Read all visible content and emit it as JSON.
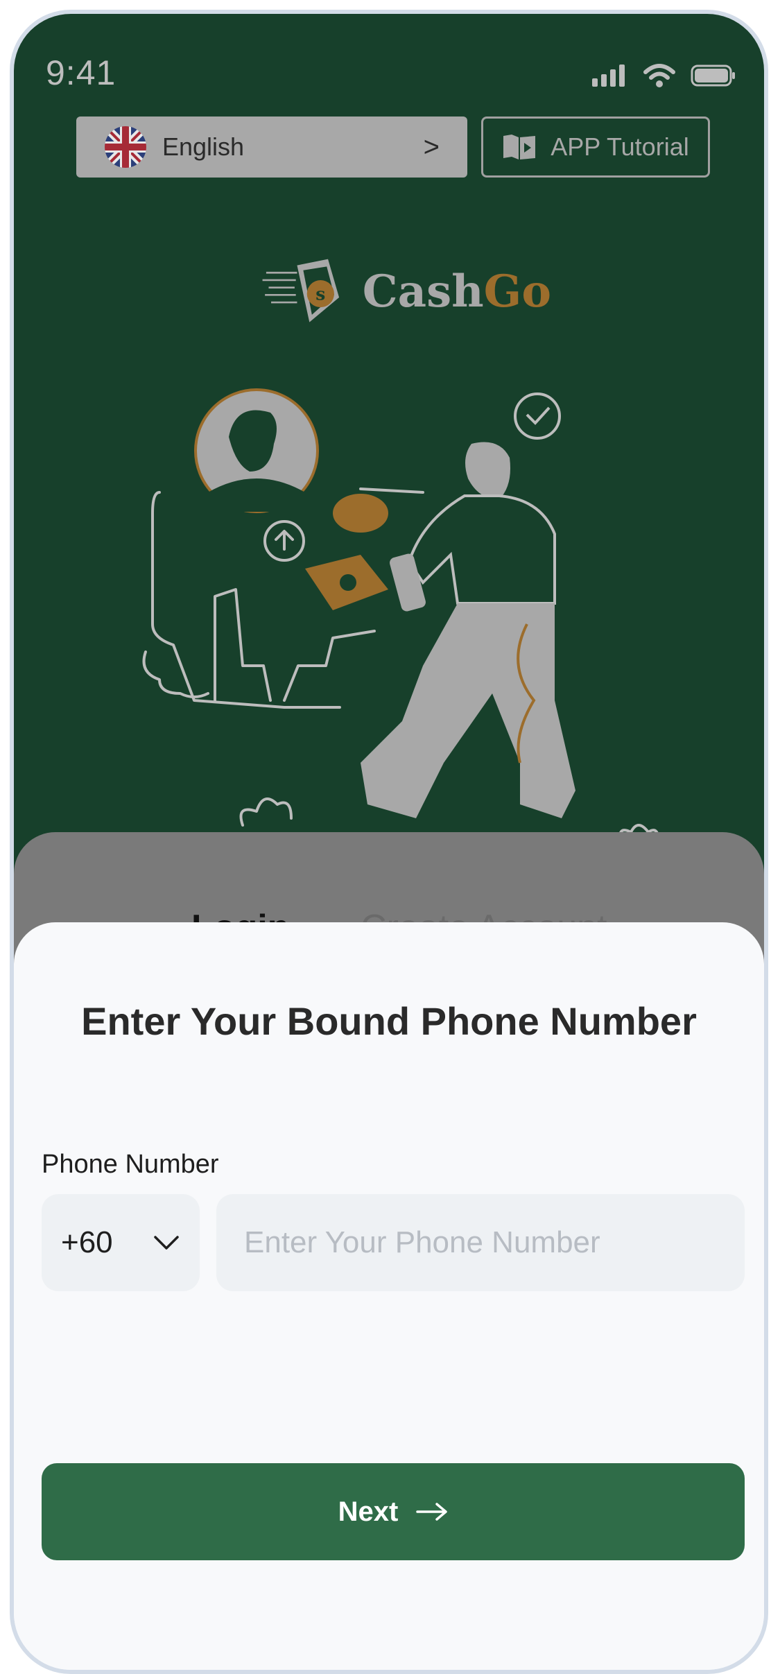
{
  "status_bar": {
    "time": "9:41",
    "icons": [
      "signal-icon",
      "wifi-icon",
      "battery-icon"
    ]
  },
  "header": {
    "language": {
      "label": "English",
      "icon": "uk-flag-icon",
      "chevron": ">"
    },
    "tutorial": {
      "label": "APP Tutorial",
      "icon": "book-icon"
    }
  },
  "brand": {
    "name_part1": "Cash",
    "name_part2": "Go",
    "accent_color": "#9c6d2c"
  },
  "tabs": [
    {
      "label": "Login"
    },
    {
      "label": "Create Account"
    }
  ],
  "modal": {
    "title": "Enter Your Bound Phone Number",
    "phone_label": "Phone Number",
    "country_code": "+60",
    "phone_placeholder": "Enter Your Phone Number",
    "next_label": "Next"
  },
  "colors": {
    "hero_bg": "#17402b",
    "primary": "#2f6c48",
    "sheet_bg": "#f8f9fb"
  }
}
